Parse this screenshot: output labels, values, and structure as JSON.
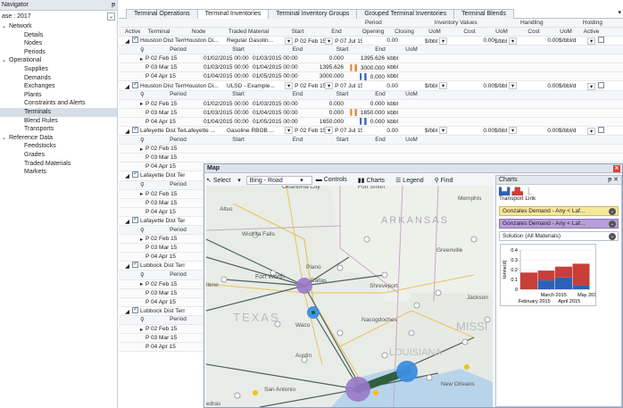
{
  "navigator": {
    "title": "Navigator",
    "pin": "ᵽ",
    "case_label": "ase : 2017",
    "groups": [
      {
        "label": "Network",
        "items": [
          "Details",
          "Nodes",
          "Periods"
        ]
      },
      {
        "label": "Operational",
        "items": [
          "Supplies",
          "Demands",
          "Exchanges",
          "Plants",
          "Constraints and Alerts",
          "Terminals",
          "Blend Rules",
          "Transports"
        ]
      },
      {
        "label": "Reference Data",
        "items": [
          "Feedstocks",
          "Grades",
          "Traded Materials",
          "Markets"
        ]
      }
    ],
    "selected": "Terminals"
  },
  "tabs": [
    "Terminal Operations",
    "Terminal Inventories",
    "Terminal Inventory Groups",
    "Grouped Terminal Inventories",
    "Terminal Blends"
  ],
  "active_tab": "Terminal Inventories",
  "grid": {
    "group_headers": {
      "period": "Period",
      "inventory": "Inventory Values",
      "handling": "Handling",
      "holding": "Holding"
    },
    "columns": [
      "Active",
      "Terminal",
      "Node",
      "Traded Material",
      "Start",
      "End",
      "Opening",
      "Closing",
      "UoM",
      "Cost",
      "UoM",
      "Cost",
      "UoM",
      "Active"
    ],
    "subcolumns": [
      "Period",
      "Start",
      "End",
      "Start",
      "End",
      "UoM"
    ],
    "blocks": [
      {
        "terminal": "Houston Dist Term...",
        "node": "Houston Di...",
        "material": "Regular Gasolin...",
        "start": "P 02 Feb 15",
        "end": "P 07 Jul 15",
        "opening": "0.00",
        "uom": "$/bbl",
        "h_cost": "0.00",
        "h_uom": "$/bbl",
        "hold_cost": "0.00",
        "hold_uom": "$/bbl/d",
        "periods": [
          {
            "period": "P 02 Feb 15",
            "start": "01/02/2015 00:00",
            "end": "01/03/2015 00:00",
            "inv_start": "0.000",
            "inv_end": "1395.626",
            "uom": "kbbl"
          },
          {
            "period": "P 03 Mar 15",
            "start": "01/03/2015 00:00",
            "end": "01/04/2015 00:00",
            "inv_start": "1395.626",
            "inv_end": "3000.000",
            "uom": "kbbl"
          },
          {
            "period": "P 04 Apr 15",
            "start": "01/04/2015 00:00",
            "end": "01/05/2015 00:00",
            "inv_start": "3000.000",
            "inv_end": "0.000",
            "uom": "kbbl"
          }
        ]
      },
      {
        "terminal": "Houston Dist Term...",
        "node": "Houston Di...",
        "material": "ULSD - Example...",
        "start": "P 02 Feb 15",
        "end": "P 07 Jul 15",
        "opening": "0.00",
        "uom": "$/bbl",
        "h_cost": "0.00",
        "h_uom": "$/bbl",
        "hold_cost": "0.00",
        "hold_uom": "$/bbl/d",
        "periods": [
          {
            "period": "P 02 Feb 15",
            "start": "01/02/2015 00:00",
            "end": "01/03/2015 00:00",
            "inv_start": "0.000",
            "inv_end": "0.000",
            "uom": "kbbl"
          },
          {
            "period": "P 03 Mar 15",
            "start": "01/03/2015 00:00",
            "end": "01/04/2015 00:00",
            "inv_start": "0.000",
            "inv_end": "1650.000",
            "uom": "kbbl"
          },
          {
            "period": "P 04 Apr 15",
            "start": "01/04/2015 00:00",
            "end": "01/05/2015 00:00",
            "inv_start": "1650.000",
            "inv_end": "0.000",
            "uom": "kbbl"
          }
        ]
      },
      {
        "terminal": "Lafeyette Dist Ter...",
        "node": "Lafeyette ...",
        "material": "Gasoline RBOB ...",
        "start": "P 02 Feb 15",
        "end": "P 07 Jul 15",
        "opening": "0.00",
        "uom": "$/bbl",
        "h_cost": "0.00",
        "h_uom": "$/bbl",
        "hold_cost": "0.00",
        "hold_uom": "$/bbl/d",
        "periods": [
          {
            "period": "P 02 Feb 15"
          },
          {
            "period": "P 03 Mar 15"
          },
          {
            "period": "P 04 Apr 15"
          }
        ]
      },
      {
        "terminal": "Lafayette Dist Ter...",
        "periods": [
          {
            "period": "P 02 Feb 15"
          },
          {
            "period": "P 03 Mar 15"
          },
          {
            "period": "P 04 Apr 15"
          }
        ]
      },
      {
        "terminal": "Lafayette Dist Ter...",
        "periods": [
          {
            "period": "P 02 Feb 15"
          },
          {
            "period": "P 03 Mar 15"
          },
          {
            "period": "P 04 Apr 15"
          }
        ]
      },
      {
        "terminal": "Lubbock Dist Termi...",
        "periods": [
          {
            "period": "P 02 Feb 15"
          },
          {
            "period": "P 03 Mar 15"
          },
          {
            "period": "P 04 Apr 15"
          }
        ]
      },
      {
        "terminal": "Lubbock Dist Termi...",
        "periods": [
          {
            "period": "P 02 Feb 15"
          },
          {
            "period": "P 03 Mar 15"
          },
          {
            "period": "P 04 Apr 15"
          }
        ]
      }
    ]
  },
  "map": {
    "title": "Map",
    "toolbar": {
      "select": "Select",
      "basemap": "Bing - Road",
      "controls": "Controls",
      "charts": "Charts",
      "legend": "Legend",
      "find": "Find"
    },
    "labels": [
      "Oklahoma City",
      "Fort Smith",
      "Memphis",
      "Altus",
      "ARKANSAS",
      "Wichita Falls",
      "Greenville",
      "Fort Worth",
      "Plano",
      "Dallas",
      "Shreveport",
      "ilene",
      "Jackson",
      "TEXAS",
      "Waco",
      "Nacogdoches",
      "MISSI",
      "Austin",
      "LOUISIANA",
      "New Orleans",
      "San Antonio",
      "edras"
    ]
  },
  "charts_panel": {
    "title": "Charts",
    "pin": "ᵽ ✕",
    "subtitle": "Transport Link",
    "selections": [
      "Gonzales Demand - Any < Laf...",
      "Gonzales Demand - Any < Laf...",
      "Solution (All Materials)"
    ],
    "colors": {
      "sel1": "#f5e79a",
      "sel2": "#b79fd9",
      "sel3": "#ffffff"
    }
  },
  "chart_data": {
    "type": "bar",
    "stacked": true,
    "ylabel": "tonne(d)",
    "ylim": [
      0,
      0.4
    ],
    "yticks": [
      "0.4",
      "0.3",
      "0.2",
      "0.1",
      "0"
    ],
    "categories": [
      "February 2015",
      "March 2015",
      "April 2015",
      "May 2015"
    ],
    "xlabels_top": [
      "March 2015",
      "May 2015"
    ],
    "xlabels_bottom": [
      "February 2015",
      "April 2015"
    ],
    "series": [
      {
        "values": [
          0.0,
          0.09,
          0.12,
          0.04
        ],
        "color": "#2d61b6"
      },
      {
        "values": [
          0.17,
          0.1,
          0.11,
          0.22
        ],
        "color": "#c83e38"
      }
    ]
  }
}
